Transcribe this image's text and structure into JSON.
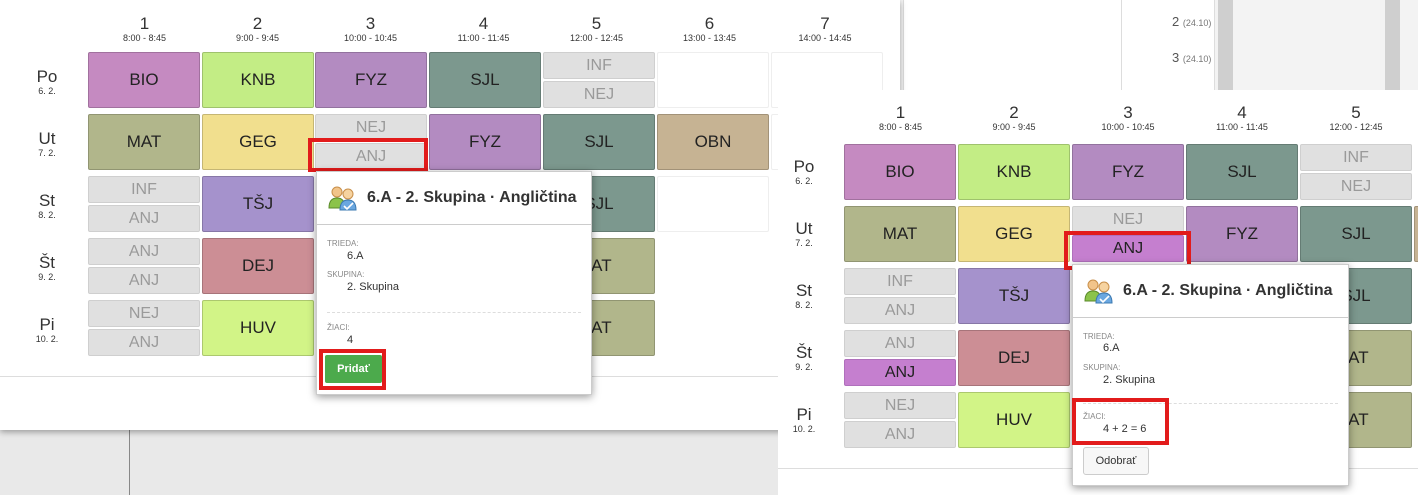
{
  "periods": [
    {
      "num": "1",
      "time": "8:00 - 8:45"
    },
    {
      "num": "2",
      "time": "9:00 - 9:45"
    },
    {
      "num": "3",
      "time": "10:00 - 10:45"
    },
    {
      "num": "4",
      "time": "11:00 - 11:45"
    },
    {
      "num": "5",
      "time": "12:00 - 12:45"
    },
    {
      "num": "6",
      "time": "13:00 - 13:45"
    },
    {
      "num": "7",
      "time": "14:00 - 14:45"
    }
  ],
  "days": [
    {
      "name": "Po",
      "date": "6. 2."
    },
    {
      "name": "Ut",
      "date": "7. 2."
    },
    {
      "name": "St",
      "date": "8. 2."
    },
    {
      "name": "Št",
      "date": "9. 2."
    },
    {
      "name": "Pi",
      "date": "10. 2."
    }
  ],
  "subjects": {
    "bio": "BIO",
    "knb": "KNB",
    "fyz": "FYZ",
    "sjl": "SJL",
    "inf": "INF",
    "nej": "NEJ",
    "mat": "MAT",
    "geg": "GEG",
    "anj": "ANJ",
    "obn": "OBN",
    "tsj": "TŠJ",
    "dej": "DEJ",
    "huv": "HUV",
    "mat_partial": "IAT"
  },
  "popup": {
    "title": "6.A - 2. Skupina · Angličtina",
    "trieda_label": "TRIEDA:",
    "trieda_value": "6.A",
    "skupina_label": "SKUPINA:",
    "skupina_value": "2. Skupina",
    "ziaci_label": "ŽIACI:",
    "ziaci_value_before": "4",
    "ziaci_value_after": "4 + 2 = 6",
    "add_button": "Pridať",
    "remove_button": "Odobrať"
  },
  "background_window": {
    "rows": [
      {
        "num": "2",
        "date": "(24.10)"
      },
      {
        "num": "3",
        "date": "(24.10)"
      }
    ]
  },
  "colors": {
    "highlight": "#e21b1b",
    "selected_anj": "#c57fcf",
    "add_button": "#4caa4c"
  }
}
